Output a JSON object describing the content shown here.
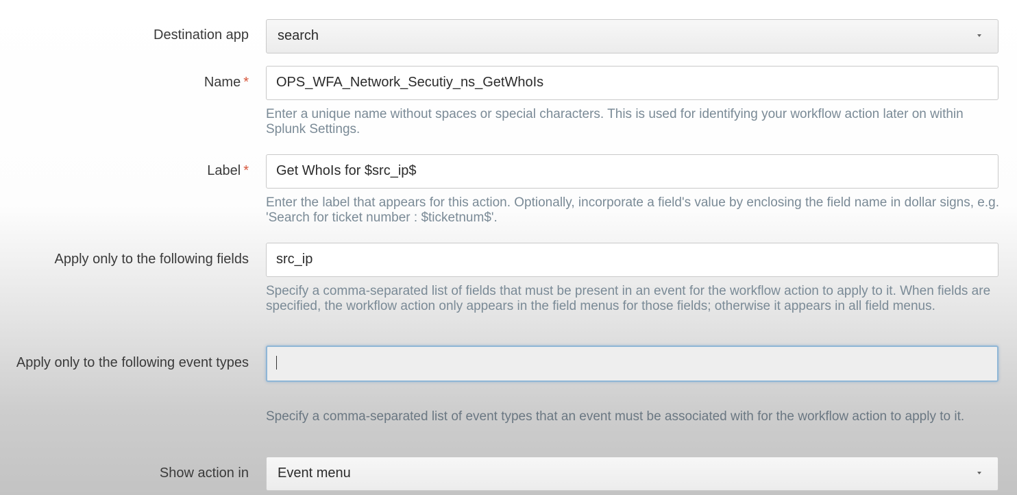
{
  "form": {
    "destination_app": {
      "label": "Destination app",
      "value": "search"
    },
    "name": {
      "label": "Name",
      "required_marker": "*",
      "value": "OPS_WFA_Network_Secutiy_ns_GetWhoIs",
      "help": "Enter a unique name without spaces or special characters. This is used for identifying your workflow action later on within Splunk Settings."
    },
    "label_field": {
      "label": "Label",
      "required_marker": "*",
      "value": "Get WhoIs for $src_ip$",
      "help": "Enter the label that appears for this action. Optionally, incorporate a field's value by enclosing the field name in dollar signs, e.g. 'Search for ticket number : $ticketnum$'."
    },
    "fields": {
      "label": "Apply only to the following fields",
      "value": "src_ip",
      "help": "Specify a comma-separated list of fields that must be present in an event for the workflow action to apply to it. When fields are specified, the workflow action only appears in the field menus for those fields; otherwise it appears in all field menus."
    },
    "event_types": {
      "label": "Apply only to the following event types",
      "value": "",
      "help": "Specify a comma-separated list of event types that an event must be associated with for the workflow action to apply to it."
    },
    "show_action_in": {
      "label": "Show action in",
      "value": "Event menu"
    }
  },
  "colors": {
    "required": "#d6563c",
    "help_text": "#7a8a96",
    "focus_border": "#8fb6d6"
  },
  "icons": {
    "dropdown": "chevron-down-icon"
  }
}
